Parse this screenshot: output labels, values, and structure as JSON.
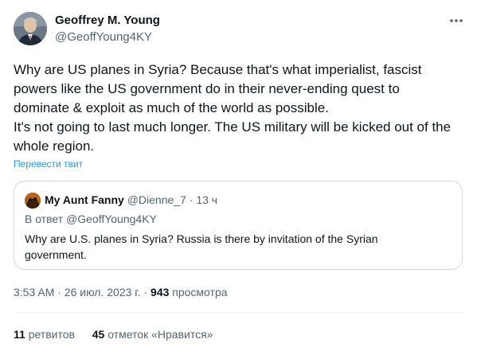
{
  "author": {
    "name": "Geoffrey M. Young",
    "handle": "@GeoffYoung4KY"
  },
  "tweet": {
    "lines": [
      "Why are US planes in Syria? Because that's what imperialist, fascist",
      "powers like the US government do in their never-ending quest to",
      "dominate & exploit as much of the world as possible.",
      "It's not going to last much longer. The US military will be kicked out of the",
      "whole region."
    ],
    "translate_label": "Перевести твит"
  },
  "quote": {
    "name": "My Aunt Fanny",
    "handle": "@Dienne_7",
    "separator": "·",
    "time": "13 ч",
    "reply_to": "В ответ @GeoffYoung4KY",
    "lines": [
      "Why are U.S. planes in Syria? Russia is there by invitation of the Syrian",
      "government."
    ]
  },
  "meta": {
    "time": "3:53 AM",
    "separator": "·",
    "date": "26 июл. 2023 г.",
    "views_count": "943",
    "views_label": "просмотра"
  },
  "stats": {
    "retweets_count": "11",
    "retweets_label": "ретвитов",
    "likes_count": "45",
    "likes_label": "отметок «Нравится»"
  },
  "colors": {
    "text": "#0f1419",
    "secondary": "#536471",
    "link": "#1d9bf0",
    "border": "#cfd9de"
  },
  "icons": {
    "more": "more-horizontal-icon"
  }
}
